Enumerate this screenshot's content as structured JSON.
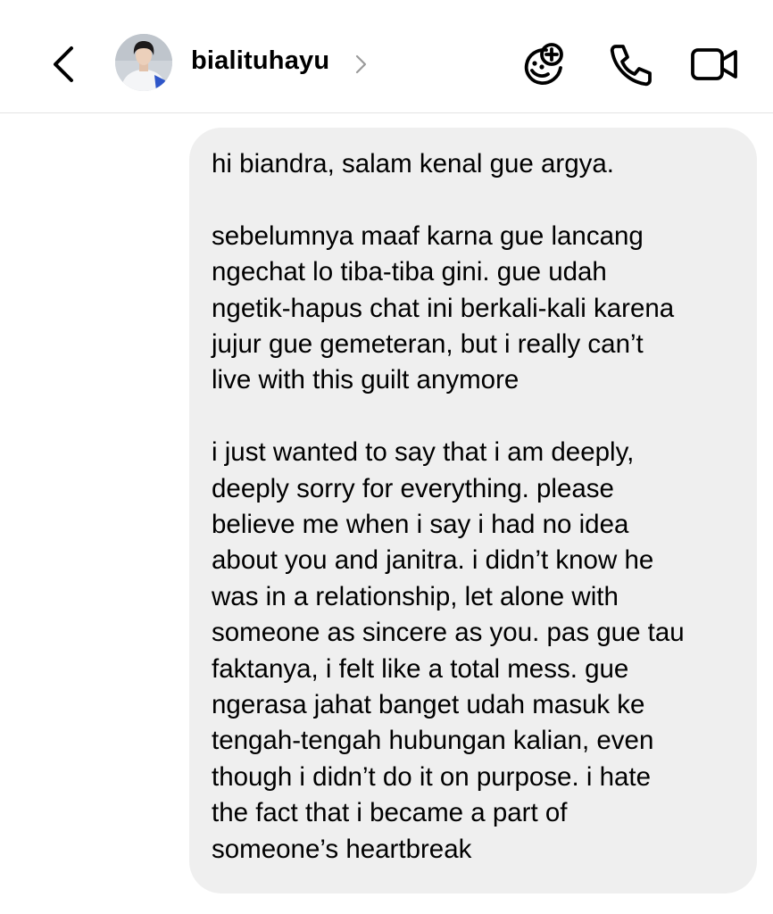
{
  "header": {
    "username": "bialituhayu",
    "icons": {
      "back": "chevron-left-icon",
      "profile_arrow": "chevron-right-icon",
      "effects": "add-effect-icon",
      "call": "phone-icon",
      "video": "video-camera-icon"
    },
    "colors": {
      "icon": "#000000",
      "chevron_gray": "#9a9a9a",
      "divider": "#e3e3e3"
    }
  },
  "message": {
    "bubble_color": "#efefef",
    "paragraphs": [
      "hi biandra, salam kenal gue argya.",
      "sebelumnya maaf karna gue lancang\nngechat lo tiba-tiba gini. gue udah\nngetik-hapus chat ini berkali-kali karena\njujur gue gemeteran, but i really can’t\nlive with this guilt anymore",
      "i just wanted to say that i am deeply,\ndeeply sorry for everything. please\nbelieve me when i say i had no idea\nabout you and janitra. i didn’t know he\nwas in a relationship, let alone with\nsomeone as sincere as you. pas gue tau\nfaktanya, i felt like a total mess. gue\nngerasa jahat banget udah masuk ke\ntengah-tengah hubungan kalian, even\nthough i didn’t do it on purpose. i hate\nthe fact that i became a part of\nsomeone’s heartbreak"
    ]
  }
}
